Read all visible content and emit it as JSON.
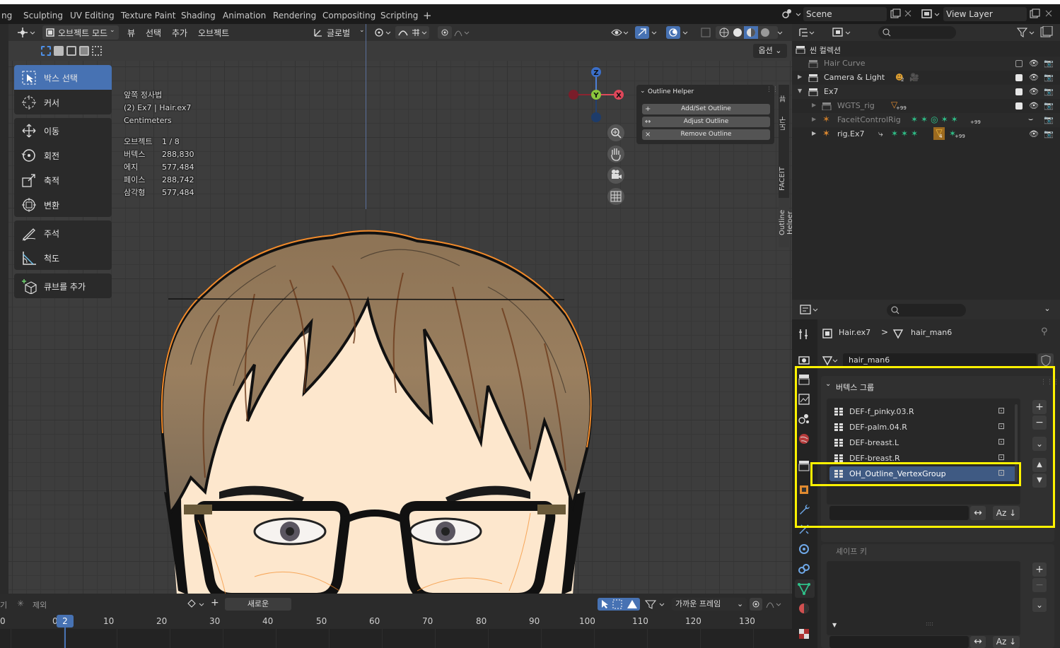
{
  "workspace_tabs": [
    "ng",
    "Sculpting",
    "UV Editing",
    "Texture Paint",
    "Shading",
    "Animation",
    "Rendering",
    "Compositing",
    "Scripting",
    "+"
  ],
  "scene": "Scene",
  "view_layer": "View Layer",
  "viewport": {
    "mode": "오브젝트 모드",
    "menus": [
      "뷰",
      "선택",
      "추가",
      "오브젝트"
    ],
    "orientation": "글로벌",
    "options": "옵션",
    "info": {
      "view_name": "앞쪽 정사법",
      "object_line": "(2) Ex7 | Hair.ex7",
      "units": "Centimeters",
      "stats": [
        {
          "label": "오브젝트",
          "value": "1 / 8"
        },
        {
          "label": "버텍스",
          "value": "288,830"
        },
        {
          "label": "에지",
          "value": "577,484"
        },
        {
          "label": "페이스",
          "value": "288,742"
        },
        {
          "label": "삼각형",
          "value": "577,484"
        }
      ]
    },
    "tools": [
      {
        "label": "박스 선택",
        "icon": "box-select-icon",
        "active": true
      },
      {
        "label": "커서",
        "icon": "cursor-icon"
      },
      {
        "label": "이동",
        "icon": "move-icon"
      },
      {
        "label": "회전",
        "icon": "rotate-icon"
      },
      {
        "label": "축적",
        "icon": "scale-icon"
      },
      {
        "label": "변환",
        "icon": "transform-icon"
      },
      {
        "label": "주석",
        "icon": "annotate-icon"
      },
      {
        "label": "척도",
        "icon": "measure-icon"
      },
      {
        "label": "큐브를 추가",
        "icon": "add-cube-icon"
      }
    ],
    "gizmo": {
      "x": "X",
      "y": "Y",
      "z": "Z"
    },
    "side_tabs": [
      "뷰",
      "도구",
      "FACEIT",
      "Outline Helper"
    ]
  },
  "outline_helper": {
    "title": "Outline Helper",
    "buttons": [
      {
        "symbol": "+",
        "label": "Add/Set Outline"
      },
      {
        "symbol": "↔",
        "label": "Adjust Outline"
      },
      {
        "symbol": "×",
        "label": "Remove Outline"
      }
    ]
  },
  "timeline": {
    "header": [
      "기",
      "제외"
    ],
    "new_label": "새로운",
    "snap": "가까운 프레임",
    "current_frame": "2",
    "ticks": [
      "0",
      "10",
      "20",
      "30",
      "40",
      "50",
      "60",
      "70",
      "80",
      "90",
      "100",
      "110",
      "120",
      "130"
    ]
  },
  "outliner": {
    "root": "씬 컬렉션",
    "rows": [
      {
        "name": "Hair Curve",
        "dim": true
      },
      {
        "name": "Camera & Light"
      },
      {
        "name": "Ex7"
      },
      {
        "name": "WGTS_rig",
        "dim": true
      },
      {
        "name": "FaceitControlRig",
        "dim": true
      },
      {
        "name": "rig.Ex7"
      }
    ],
    "badges": {
      "camera": "2",
      "wgts": "99",
      "faceit": "99",
      "rig_count": "4",
      "rig": "99"
    }
  },
  "properties": {
    "breadcrumb_object": "Hair.ex7",
    "breadcrumb_data": "hair_man6",
    "mesh_name": "hair_man6",
    "panel_title": "버텍스 그룹",
    "vertex_groups": [
      "DEF-f_pinky.03.R",
      "DEF-palm.04.R",
      "DEF-breast.L",
      "DEF-breast.R",
      "OH_Outline_VertexGroup"
    ],
    "selected_index": 4,
    "next_panel": "셰이프 키"
  },
  "colors": {
    "accent": "#4772b3",
    "highlight": "#fff200",
    "selection_orange": "#f38b2a"
  }
}
